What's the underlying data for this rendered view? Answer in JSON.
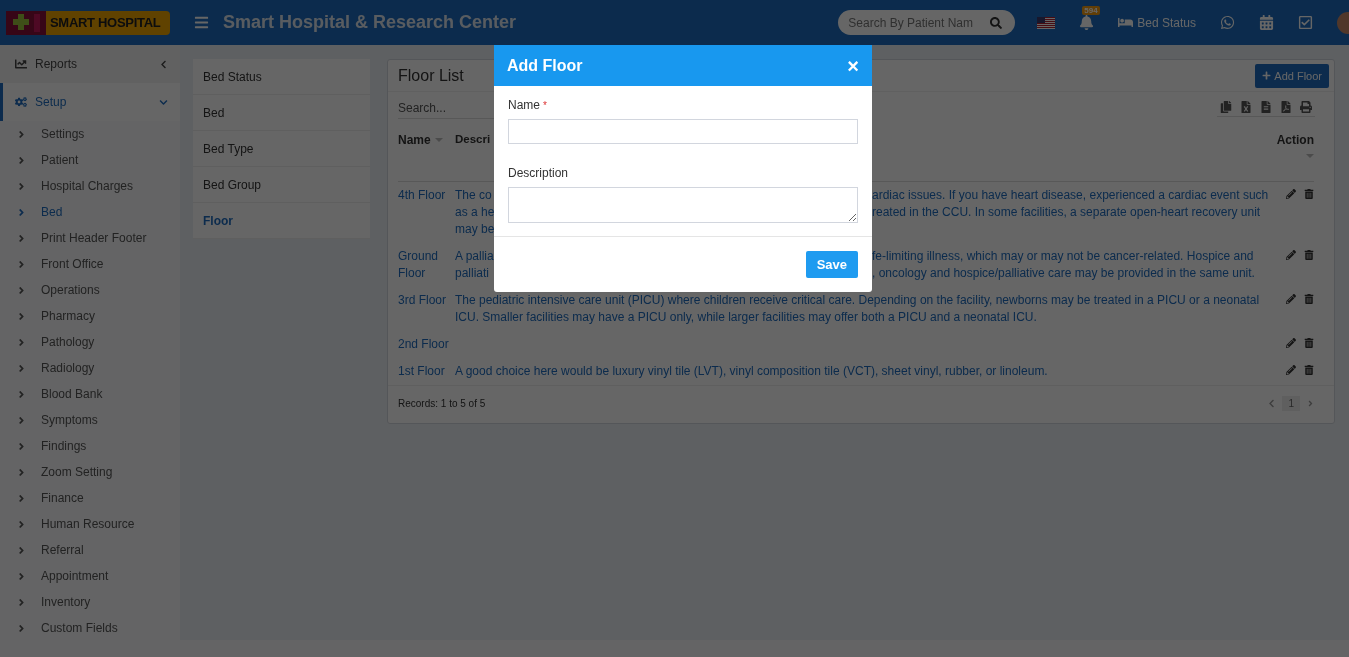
{
  "header": {
    "logo": "SMART HOSPITAL",
    "title": "Smart Hospital & Research Center",
    "search": {
      "placeholder": "Search By Patient Nam"
    },
    "notification_count": "594",
    "bed_status": "Bed Status"
  },
  "sidebar": {
    "items": [
      {
        "label": "Reports",
        "expanded": false,
        "selected": false
      },
      {
        "label": "Setup",
        "expanded": true,
        "selected": true,
        "children": [
          {
            "label": "Settings",
            "selected": false
          },
          {
            "label": "Patient",
            "selected": false
          },
          {
            "label": "Hospital Charges",
            "selected": false
          },
          {
            "label": "Bed",
            "selected": true
          },
          {
            "label": "Print Header Footer",
            "selected": false
          },
          {
            "label": "Front Office",
            "selected": false
          },
          {
            "label": "Operations",
            "selected": false
          },
          {
            "label": "Pharmacy",
            "selected": false
          },
          {
            "label": "Pathology",
            "selected": false
          },
          {
            "label": "Radiology",
            "selected": false
          },
          {
            "label": "Blood Bank",
            "selected": false
          },
          {
            "label": "Symptoms",
            "selected": false
          },
          {
            "label": "Findings",
            "selected": false
          },
          {
            "label": "Zoom Setting",
            "selected": false
          },
          {
            "label": "Finance",
            "selected": false
          },
          {
            "label": "Human Resource",
            "selected": false
          },
          {
            "label": "Referral",
            "selected": false
          },
          {
            "label": "Appointment",
            "selected": false
          },
          {
            "label": "Inventory",
            "selected": false
          },
          {
            "label": "Custom Fields",
            "selected": false
          }
        ]
      }
    ]
  },
  "subnav": [
    {
      "label": "Bed Status",
      "selected": false
    },
    {
      "label": "Bed",
      "selected": false
    },
    {
      "label": "Bed Type",
      "selected": false
    },
    {
      "label": "Bed Group",
      "selected": false
    },
    {
      "label": "Floor",
      "selected": true
    }
  ],
  "floor_list": {
    "title": "Floor List",
    "add_button": "Add Floor",
    "search": {
      "placeholder": "Search..."
    },
    "columns": [
      "Name",
      "Descri",
      "Action"
    ],
    "rows": [
      {
        "name": "4th Floor",
        "description_left": [
          "The co",
          "as a he",
          "may be"
        ],
        "description_right": [
          "ardiac issues. If you have heart disease, experienced a cardiac event such",
          "reated in the CCU. In some facilities, a separate open-heart recovery unit"
        ]
      },
      {
        "name": "Ground Floor",
        "description_left": [
          "A pallia",
          "palliati"
        ],
        "description_right": [
          "fe-limiting illness, which may or may not be cancer-related. Hospice and",
          ", oncology and hospice/palliative care may be provided in the same unit."
        ]
      },
      {
        "name": "3rd Floor",
        "description": "The pediatric intensive care unit (PICU) where children receive critical care. Depending on the facility, newborns may be treated in a PICU or a neonatal ICU. Smaller facilities may have a PICU only, while larger facilities may offer both a PICU and a neonatal ICU."
      },
      {
        "name": "2nd Floor"
      },
      {
        "name": "1st Floor",
        "description": "A good choice here would be luxury vinyl tile (LVT), vinyl composition tile (VCT), sheet vinyl, rubber, or linoleum."
      }
    ],
    "records": "Records: 1 to 5 of 5",
    "page": "1"
  },
  "modal": {
    "title": "Add Floor",
    "close": "×",
    "required_mark": "*",
    "fields": [
      {
        "label": "Name",
        "required": true,
        "kind": "input"
      },
      {
        "label": "Description",
        "required": false,
        "kind": "textarea"
      }
    ],
    "save": "Save"
  }
}
